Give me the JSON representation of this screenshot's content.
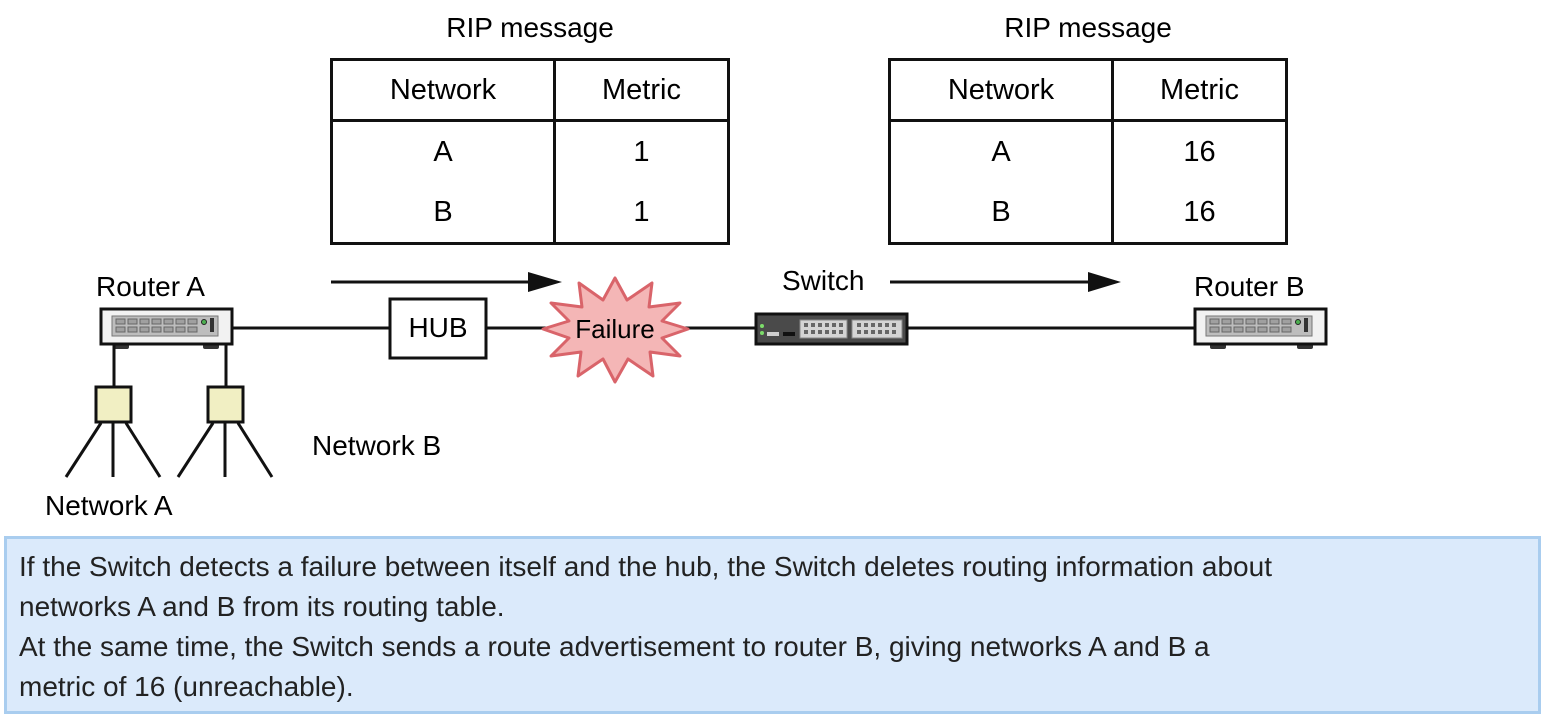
{
  "rip_messages": [
    {
      "title": "RIP message",
      "headers": [
        "Network",
        "Metric"
      ],
      "rows": [
        [
          "A",
          "1"
        ],
        [
          "B",
          "1"
        ]
      ]
    },
    {
      "title": "RIP message",
      "headers": [
        "Network",
        "Metric"
      ],
      "rows": [
        [
          "A",
          "16"
        ],
        [
          "B",
          "16"
        ]
      ]
    }
  ],
  "nodes": {
    "router_a": "Router A",
    "router_b": "Router B",
    "hub": "HUB",
    "failure": "Failure",
    "switch": "Switch",
    "network_a": "Network A",
    "network_b": "Network B"
  },
  "colors": {
    "failure_fill": "#f4b6b6",
    "failure_stroke": "#d9646a",
    "hub_node_fill": "#f1efc3",
    "info_bg": "#dbeafb",
    "info_border": "#a9cdef"
  },
  "description": {
    "lines": [
      "If the Switch detects a failure between itself and the hub, the Switch deletes routing information about",
      "networks A and B from its routing table.",
      "At the same time, the Switch sends a route advertisement to router B, giving networks A and B a",
      "metric of 16 (unreachable)."
    ]
  }
}
